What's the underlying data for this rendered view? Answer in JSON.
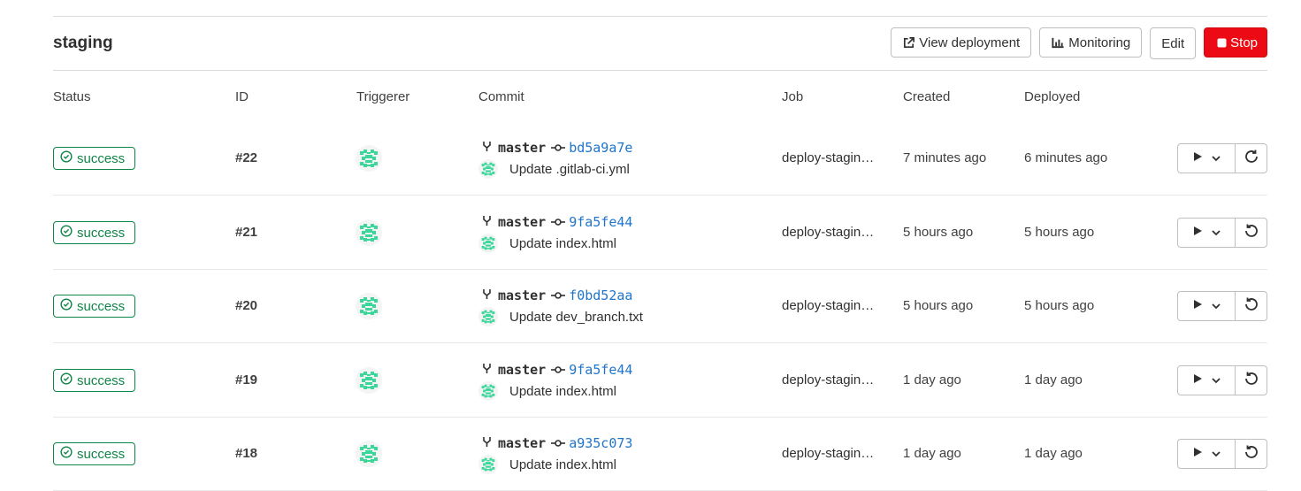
{
  "environment": {
    "name": "staging"
  },
  "actions": {
    "view_deployment": "View deployment",
    "monitoring": "Monitoring",
    "edit": "Edit",
    "stop": "Stop"
  },
  "columns": {
    "status": "Status",
    "id": "ID",
    "triggerer": "Triggerer",
    "commit": "Commit",
    "job": "Job",
    "created": "Created",
    "deployed": "Deployed"
  },
  "rows": [
    {
      "status": "success",
      "id": "#22",
      "branch": "master",
      "sha": "bd5a9a7e",
      "message": "Update .gitlab-ci.yml",
      "job": "deploy-stagin…",
      "created": "7 minutes ago",
      "deployed": "6 minutes ago"
    },
    {
      "status": "success",
      "id": "#21",
      "branch": "master",
      "sha": "9fa5fe44",
      "message": "Update index.html",
      "job": "deploy-stagin…",
      "created": "5 hours ago",
      "deployed": "5 hours ago"
    },
    {
      "status": "success",
      "id": "#20",
      "branch": "master",
      "sha": "f0bd52aa",
      "message": "Update dev_branch.txt",
      "job": "deploy-stagin…",
      "created": "5 hours ago",
      "deployed": "5 hours ago"
    },
    {
      "status": "success",
      "id": "#19",
      "branch": "master",
      "sha": "9fa5fe44",
      "message": "Update index.html",
      "job": "deploy-stagin…",
      "created": "1 day ago",
      "deployed": "1 day ago"
    },
    {
      "status": "success",
      "id": "#18",
      "branch": "master",
      "sha": "a935c073",
      "message": "Update index.html",
      "job": "deploy-stagin…",
      "created": "1 day ago",
      "deployed": "1 day ago"
    }
  ],
  "colors": {
    "success": "#108548",
    "link": "#1f75cb",
    "danger": "#ec0b14",
    "avatar": "#3ad79a"
  }
}
